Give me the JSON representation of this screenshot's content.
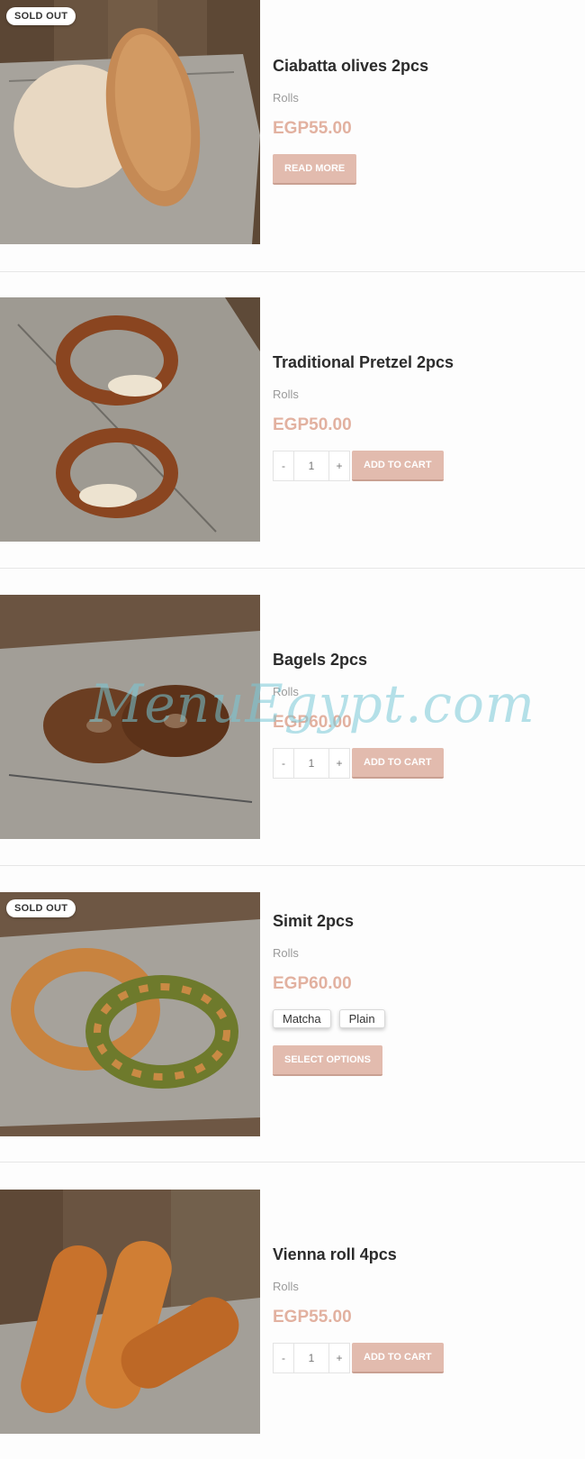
{
  "products": [
    {
      "name": "Ciabatta olives 2pcs",
      "category": "Rolls",
      "price": "EGP55.00",
      "badge": "SOLD OUT",
      "action_label": "READ MORE"
    },
    {
      "name": "Traditional Pretzel 2pcs",
      "category": "Rolls",
      "price": "EGP50.00",
      "qty_minus": "-",
      "qty_value": "1",
      "qty_plus": "+",
      "action_label": "ADD TO CART"
    },
    {
      "name": "Bagels 2pcs",
      "category": "Rolls",
      "price": "EGP60.00",
      "qty_minus": "-",
      "qty_value": "1",
      "qty_plus": "+",
      "action_label": "ADD TO CART"
    },
    {
      "name": "Simit 2pcs",
      "category": "Rolls",
      "price": "EGP60.00",
      "badge": "SOLD OUT",
      "options": [
        "Matcha",
        "Plain"
      ],
      "action_label": "SELECT OPTIONS"
    },
    {
      "name": "Vienna roll 4pcs",
      "category": "Rolls",
      "price": "EGP55.00",
      "qty_minus": "-",
      "qty_value": "1",
      "qty_plus": "+",
      "action_label": "ADD TO CART"
    }
  ],
  "watermark": "MenuEgypt.com",
  "colors": {
    "price": "#e2b1a0",
    "button": "#e2bbae",
    "title": "#2c2c2c",
    "category": "#9a9a9a"
  }
}
